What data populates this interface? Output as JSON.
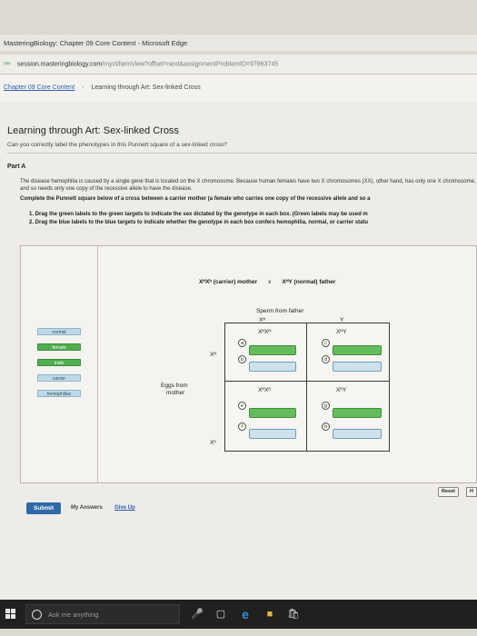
{
  "window": {
    "title": "MasteringBiology: Chapter 09 Core Content - Microsoft Edge"
  },
  "address": {
    "host": "session.masteringbiology.com",
    "path": "/myct/itemView?offset=next&assignmentProblemID=97863745"
  },
  "breadcrumb": {
    "chapter": "Chapter 09 Core Content",
    "current": "Learning through Art: Sex-linked Cross"
  },
  "page": {
    "title": "Learning through Art: Sex-linked Cross",
    "subtitle": "Can you correctly label the phenotypes in this Punnett square of a sex-linked cross?",
    "part": "Part A",
    "intro": "The disease hemophilia is caused by a single gene that is located on the X chromosome. Because human females have two X chromosomes (XX), other hand, has only one X chromosome, and so needs only one copy of the recessive allele to have the disease.",
    "instruction": "Complete the Punnett square below of a cross between a carrier mother (a female who carries one copy of the recessive allele and so a",
    "steps": [
      "1. Drag the green labels to the green targets to indicate the sex dictated by the genotype in each box. (Green labels may be used m",
      "2. Drag the blue labels to the blue targets to indicate whether the genotype in each box confers hemophilia, normal, or carrier statu"
    ]
  },
  "cross": {
    "mother": "XᴴXʰ (carrier) mother",
    "times": "x",
    "father": "XᴴY (normal) father"
  },
  "labels": [
    {
      "text": "normal",
      "color": "blue"
    },
    {
      "text": "female",
      "color": "green"
    },
    {
      "text": "male",
      "color": "green"
    },
    {
      "text": "carrier",
      "color": "blue"
    },
    {
      "text": "hemophiliac",
      "color": "blue"
    }
  ],
  "punnett": {
    "sperm_label": "Sperm from father",
    "father_gametes": [
      "Xᴴ",
      "Y"
    ],
    "eggs_label_1": "Eggs from",
    "eggs_label_2": "mother",
    "mother_gametes": [
      "Xᴴ",
      "Xʰ"
    ],
    "cells": [
      {
        "genotype": "XᴴXᴴ",
        "targets": [
          "a",
          "b"
        ]
      },
      {
        "genotype": "XᴴY",
        "targets": [
          "c",
          "d"
        ]
      },
      {
        "genotype": "XᴴXʰ",
        "targets": [
          "e",
          "f"
        ]
      },
      {
        "genotype": "XʰY",
        "targets": [
          "g",
          "h"
        ]
      }
    ]
  },
  "actions": {
    "reset": "Reset",
    "help": "H",
    "submit": "Submit",
    "my_answers": "My Answers",
    "give_up": "Give Up"
  },
  "taskbar": {
    "search_placeholder": "Ask me anything"
  },
  "colors": {
    "green_label": "#4fae4f",
    "blue_label": "#bcd9ea",
    "submit": "#2e6aa8",
    "link": "#2a5db0"
  }
}
